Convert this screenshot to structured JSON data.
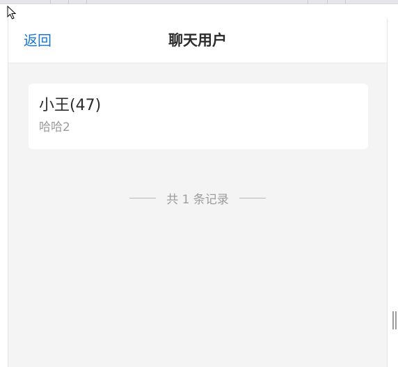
{
  "header": {
    "back_label": "返回",
    "title": "聊天用户"
  },
  "chat_list": [
    {
      "name": "小王(47)",
      "last_message": "哈哈2"
    }
  ],
  "footer": {
    "record_count_text": "共 1 条记录"
  },
  "colors": {
    "accent": "#1677d6",
    "background": "#f4f4f5",
    "card": "#ffffff",
    "muted_text": "#9a9a9a"
  },
  "icons": {
    "cursor": "mouse-pointer-icon",
    "resize": "resize-handle-icon"
  }
}
